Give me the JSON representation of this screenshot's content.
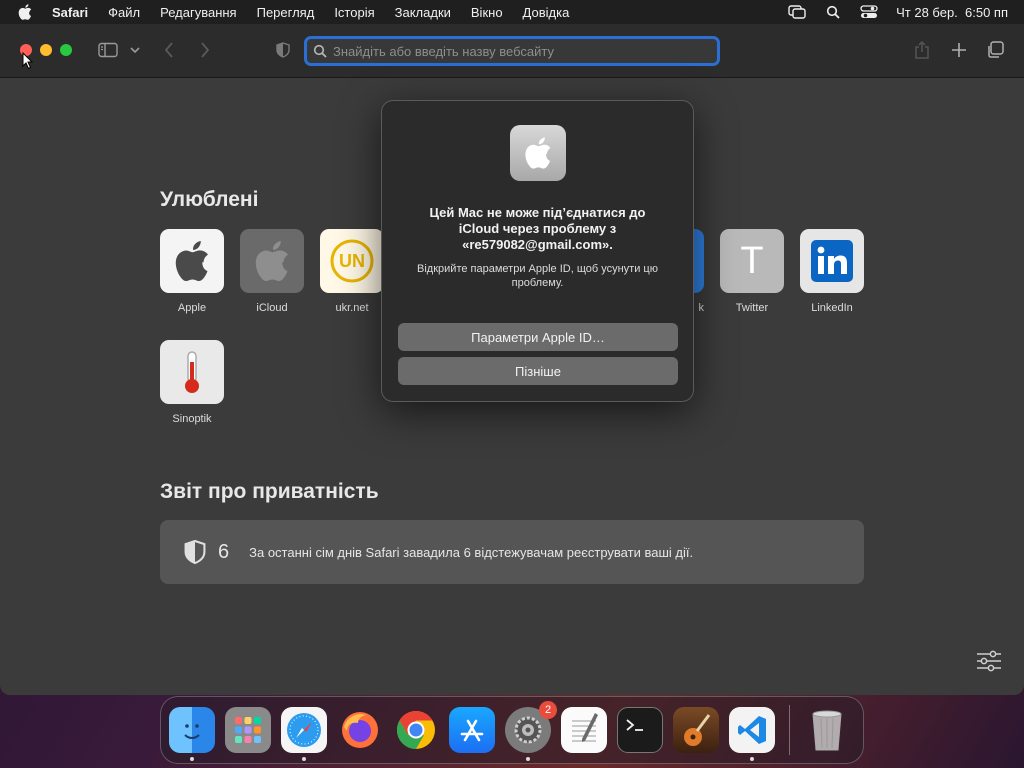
{
  "menubar": {
    "app": "Safari",
    "items": [
      "Файл",
      "Редагування",
      "Перегляд",
      "Історія",
      "Закладки",
      "Вікно",
      "Довідка"
    ],
    "datetime": "Чт 28 бер.  6:50 пп"
  },
  "toolbar": {
    "address_placeholder": "Знайдіть або введіть назву вебсайту"
  },
  "favorites": {
    "title": "Улюблені",
    "items": [
      "Apple",
      "iCloud",
      "ukr.net",
      "k",
      "Twitter",
      "LinkedIn",
      "Sinoptik"
    ]
  },
  "privacy": {
    "title": "Звіт про приватність",
    "count": "6",
    "text": "За останні сім днів Safari завадила 6 відстежувачам реєструвати ваші дії."
  },
  "dialog": {
    "title": "Цей Mac не може під’єднатися до iCloud через проблему з «re579082@gmail.com».",
    "message": "Відкрийте параметри Apple ID, щоб усунути цю проблему.",
    "primary_button": "Параметри Apple ID…",
    "secondary_button": "Пізніше"
  },
  "dock": {
    "apps": [
      "finder",
      "launchpad",
      "safari",
      "firefox",
      "chrome",
      "app-store",
      "system-settings",
      "textedit",
      "terminal",
      "garageband",
      "vscode",
      "trash"
    ],
    "settings_badge": "2"
  },
  "colors": {
    "accent": "#2a6fd6",
    "close": "#ff5f57",
    "minimize": "#febc2e",
    "maximize": "#28c840"
  }
}
